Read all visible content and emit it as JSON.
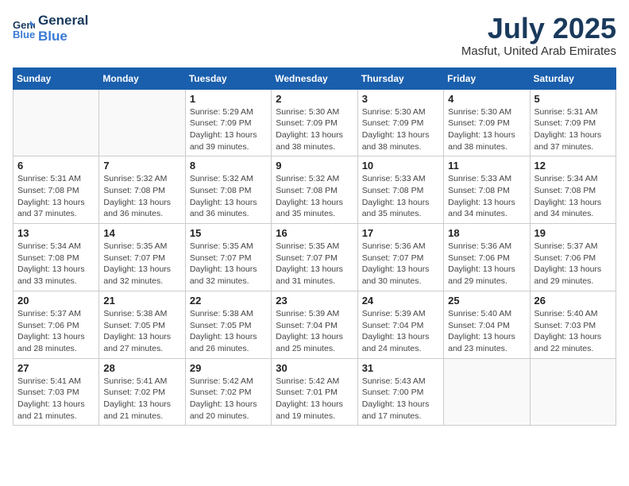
{
  "header": {
    "logo_line1": "General",
    "logo_line2": "Blue",
    "month_title": "July 2025",
    "subtitle": "Masfut, United Arab Emirates"
  },
  "weekdays": [
    "Sunday",
    "Monday",
    "Tuesday",
    "Wednesday",
    "Thursday",
    "Friday",
    "Saturday"
  ],
  "weeks": [
    [
      {
        "day": "",
        "detail": ""
      },
      {
        "day": "",
        "detail": ""
      },
      {
        "day": "1",
        "detail": "Sunrise: 5:29 AM\nSunset: 7:09 PM\nDaylight: 13 hours\nand 39 minutes."
      },
      {
        "day": "2",
        "detail": "Sunrise: 5:30 AM\nSunset: 7:09 PM\nDaylight: 13 hours\nand 38 minutes."
      },
      {
        "day": "3",
        "detail": "Sunrise: 5:30 AM\nSunset: 7:09 PM\nDaylight: 13 hours\nand 38 minutes."
      },
      {
        "day": "4",
        "detail": "Sunrise: 5:30 AM\nSunset: 7:09 PM\nDaylight: 13 hours\nand 38 minutes."
      },
      {
        "day": "5",
        "detail": "Sunrise: 5:31 AM\nSunset: 7:09 PM\nDaylight: 13 hours\nand 37 minutes."
      }
    ],
    [
      {
        "day": "6",
        "detail": "Sunrise: 5:31 AM\nSunset: 7:08 PM\nDaylight: 13 hours\nand 37 minutes."
      },
      {
        "day": "7",
        "detail": "Sunrise: 5:32 AM\nSunset: 7:08 PM\nDaylight: 13 hours\nand 36 minutes."
      },
      {
        "day": "8",
        "detail": "Sunrise: 5:32 AM\nSunset: 7:08 PM\nDaylight: 13 hours\nand 36 minutes."
      },
      {
        "day": "9",
        "detail": "Sunrise: 5:32 AM\nSunset: 7:08 PM\nDaylight: 13 hours\nand 35 minutes."
      },
      {
        "day": "10",
        "detail": "Sunrise: 5:33 AM\nSunset: 7:08 PM\nDaylight: 13 hours\nand 35 minutes."
      },
      {
        "day": "11",
        "detail": "Sunrise: 5:33 AM\nSunset: 7:08 PM\nDaylight: 13 hours\nand 34 minutes."
      },
      {
        "day": "12",
        "detail": "Sunrise: 5:34 AM\nSunset: 7:08 PM\nDaylight: 13 hours\nand 34 minutes."
      }
    ],
    [
      {
        "day": "13",
        "detail": "Sunrise: 5:34 AM\nSunset: 7:08 PM\nDaylight: 13 hours\nand 33 minutes."
      },
      {
        "day": "14",
        "detail": "Sunrise: 5:35 AM\nSunset: 7:07 PM\nDaylight: 13 hours\nand 32 minutes."
      },
      {
        "day": "15",
        "detail": "Sunrise: 5:35 AM\nSunset: 7:07 PM\nDaylight: 13 hours\nand 32 minutes."
      },
      {
        "day": "16",
        "detail": "Sunrise: 5:35 AM\nSunset: 7:07 PM\nDaylight: 13 hours\nand 31 minutes."
      },
      {
        "day": "17",
        "detail": "Sunrise: 5:36 AM\nSunset: 7:07 PM\nDaylight: 13 hours\nand 30 minutes."
      },
      {
        "day": "18",
        "detail": "Sunrise: 5:36 AM\nSunset: 7:06 PM\nDaylight: 13 hours\nand 29 minutes."
      },
      {
        "day": "19",
        "detail": "Sunrise: 5:37 AM\nSunset: 7:06 PM\nDaylight: 13 hours\nand 29 minutes."
      }
    ],
    [
      {
        "day": "20",
        "detail": "Sunrise: 5:37 AM\nSunset: 7:06 PM\nDaylight: 13 hours\nand 28 minutes."
      },
      {
        "day": "21",
        "detail": "Sunrise: 5:38 AM\nSunset: 7:05 PM\nDaylight: 13 hours\nand 27 minutes."
      },
      {
        "day": "22",
        "detail": "Sunrise: 5:38 AM\nSunset: 7:05 PM\nDaylight: 13 hours\nand 26 minutes."
      },
      {
        "day": "23",
        "detail": "Sunrise: 5:39 AM\nSunset: 7:04 PM\nDaylight: 13 hours\nand 25 minutes."
      },
      {
        "day": "24",
        "detail": "Sunrise: 5:39 AM\nSunset: 7:04 PM\nDaylight: 13 hours\nand 24 minutes."
      },
      {
        "day": "25",
        "detail": "Sunrise: 5:40 AM\nSunset: 7:04 PM\nDaylight: 13 hours\nand 23 minutes."
      },
      {
        "day": "26",
        "detail": "Sunrise: 5:40 AM\nSunset: 7:03 PM\nDaylight: 13 hours\nand 22 minutes."
      }
    ],
    [
      {
        "day": "27",
        "detail": "Sunrise: 5:41 AM\nSunset: 7:03 PM\nDaylight: 13 hours\nand 21 minutes."
      },
      {
        "day": "28",
        "detail": "Sunrise: 5:41 AM\nSunset: 7:02 PM\nDaylight: 13 hours\nand 21 minutes."
      },
      {
        "day": "29",
        "detail": "Sunrise: 5:42 AM\nSunset: 7:02 PM\nDaylight: 13 hours\nand 20 minutes."
      },
      {
        "day": "30",
        "detail": "Sunrise: 5:42 AM\nSunset: 7:01 PM\nDaylight: 13 hours\nand 19 minutes."
      },
      {
        "day": "31",
        "detail": "Sunrise: 5:43 AM\nSunset: 7:00 PM\nDaylight: 13 hours\nand 17 minutes."
      },
      {
        "day": "",
        "detail": ""
      },
      {
        "day": "",
        "detail": ""
      }
    ]
  ]
}
